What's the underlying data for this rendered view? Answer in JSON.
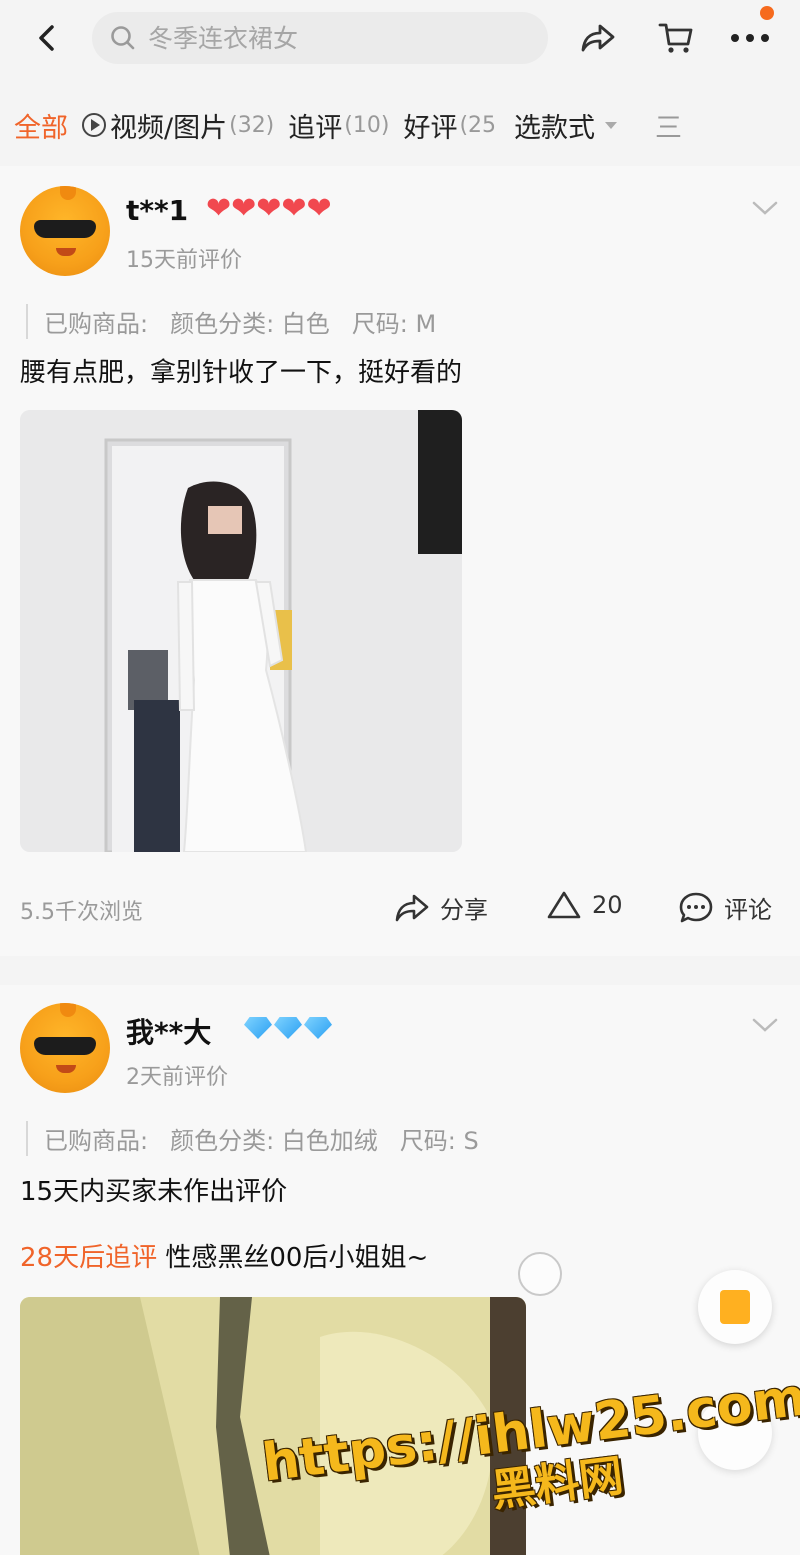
{
  "search": {
    "placeholder": "冬季连衣裙女"
  },
  "tabs": [
    {
      "label": "全部",
      "count": ""
    },
    {
      "label": "视频/图片",
      "count": "(32)"
    },
    {
      "label": "追评",
      "count": "(10)"
    },
    {
      "label": "好评",
      "count": "(25"
    },
    {
      "label": "选款式",
      "count": ""
    },
    {
      "label": "三",
      "count": ""
    }
  ],
  "reviews": [
    {
      "username": "t**1",
      "hearts": "❤❤❤❤❤",
      "time": "15天前评价",
      "purchased_label": "已购商品:",
      "color": "颜色分类: 白色",
      "size": "尺码: M",
      "text": "腰有点肥，拿别针收了一下，挺好看的",
      "views": "5.5千次浏览",
      "share_label": "分享",
      "like_count": "20",
      "comment_label": "评论"
    },
    {
      "username": "我**大",
      "time": "2天前评价",
      "purchased_label": "已购商品:",
      "color": "颜色分类: 白色加绒",
      "size": "尺码: S",
      "text": "15天内买家未作出评价",
      "followup_tag": "28天后追评",
      "followup_text": "性感黑丝00后小姐姐~"
    }
  ],
  "watermark": {
    "url": "https://ihlw25.com",
    "name": "黑料网"
  },
  "colors": {
    "accent": "#f0642a",
    "heart": "#f1484f",
    "diamond": "#2a9ff2",
    "watermark": "#f5b81c"
  }
}
